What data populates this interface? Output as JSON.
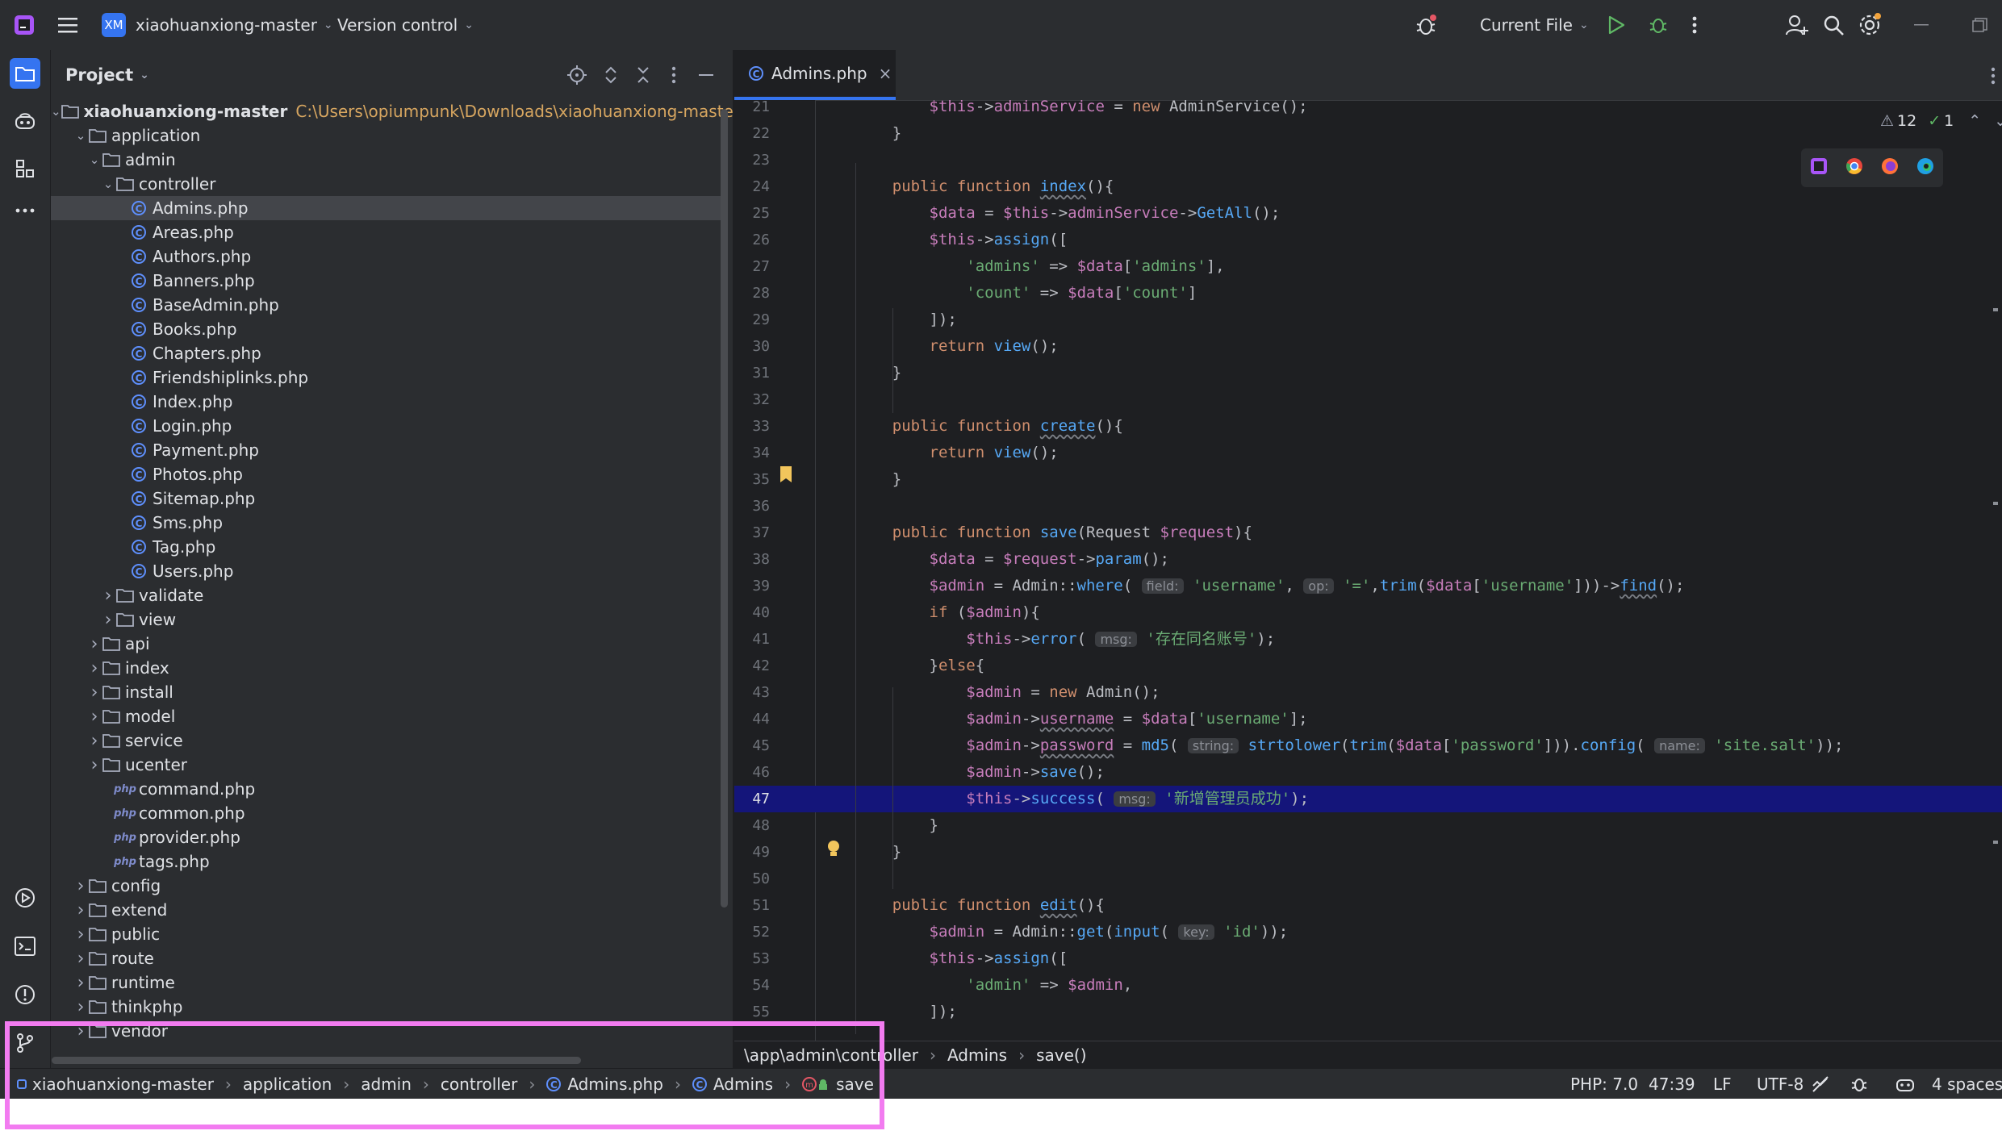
{
  "titlebar": {
    "project_badge": "XM",
    "project_name": "xiaohuanxiong-master",
    "vcs_label": "Version control",
    "run_config": "Current File",
    "colors": {
      "badge_bg": "#3574f0",
      "run_green": "#5fb865"
    }
  },
  "project_panel": {
    "title": "Project",
    "root": {
      "name": "xiaohuanxiong-master",
      "path": "C:\\Users\\opiumpunk\\Downloads\\xiaohuanxiong-master\\x"
    },
    "tree": [
      {
        "label": "application",
        "kind": "folder",
        "state": "open"
      },
      {
        "label": "admin",
        "kind": "folder",
        "state": "open"
      },
      {
        "label": "controller",
        "kind": "folder",
        "state": "open"
      },
      {
        "label": "Admins.php",
        "kind": "class",
        "selected": true
      },
      {
        "label": "Areas.php",
        "kind": "class"
      },
      {
        "label": "Authors.php",
        "kind": "class"
      },
      {
        "label": "Banners.php",
        "kind": "class"
      },
      {
        "label": "BaseAdmin.php",
        "kind": "class"
      },
      {
        "label": "Books.php",
        "kind": "class"
      },
      {
        "label": "Chapters.php",
        "kind": "class"
      },
      {
        "label": "Friendshiplinks.php",
        "kind": "class"
      },
      {
        "label": "Index.php",
        "kind": "class"
      },
      {
        "label": "Login.php",
        "kind": "class"
      },
      {
        "label": "Payment.php",
        "kind": "class"
      },
      {
        "label": "Photos.php",
        "kind": "class"
      },
      {
        "label": "Sitemap.php",
        "kind": "class"
      },
      {
        "label": "Sms.php",
        "kind": "class"
      },
      {
        "label": "Tag.php",
        "kind": "class"
      },
      {
        "label": "Users.php",
        "kind": "class"
      },
      {
        "label": "validate",
        "kind": "folder",
        "state": "closed"
      },
      {
        "label": "view",
        "kind": "folder",
        "state": "closed"
      },
      {
        "label": "api",
        "kind": "folder",
        "state": "closed"
      },
      {
        "label": "index",
        "kind": "folder",
        "state": "closed"
      },
      {
        "label": "install",
        "kind": "folder",
        "state": "closed"
      },
      {
        "label": "model",
        "kind": "folder",
        "state": "closed"
      },
      {
        "label": "service",
        "kind": "folder",
        "state": "closed"
      },
      {
        "label": "ucenter",
        "kind": "folder",
        "state": "closed"
      },
      {
        "label": "command.php",
        "kind": "php"
      },
      {
        "label": "common.php",
        "kind": "php"
      },
      {
        "label": "provider.php",
        "kind": "php"
      },
      {
        "label": "tags.php",
        "kind": "php"
      },
      {
        "label": "config",
        "kind": "folder",
        "state": "closed"
      },
      {
        "label": "extend",
        "kind": "folder",
        "state": "closed"
      },
      {
        "label": "public",
        "kind": "folder",
        "state": "closed"
      },
      {
        "label": "route",
        "kind": "folder",
        "state": "closed"
      },
      {
        "label": "runtime",
        "kind": "folder",
        "state": "closed"
      },
      {
        "label": "thinkphp",
        "kind": "folder",
        "state": "closed"
      },
      {
        "label": "vendor",
        "kind": "folder",
        "state": "closed"
      }
    ]
  },
  "editor": {
    "tab": "Admins.php",
    "inspections": {
      "warnings": "12",
      "ok": "1"
    },
    "current_line": "47",
    "code": [
      {
        "n": "21",
        "html": "        <span class=\"var\">$this</span>-><span class=\"var\">adminService</span> = <span class=\"kw\">new</span> AdminService();"
      },
      {
        "n": "22",
        "html": "    }"
      },
      {
        "n": "23",
        "html": ""
      },
      {
        "n": "24",
        "html": "    <span class=\"kw\">public function</span> <span class=\"fn ul\">index</span>(){"
      },
      {
        "n": "25",
        "html": "        <span class=\"var\">$data</span> = <span class=\"var\">$this</span>-><span class=\"var\">adminService</span>-><span class=\"fn\">GetAll</span>();"
      },
      {
        "n": "26",
        "html": "        <span class=\"var\">$this</span>-><span class=\"fn\">assign</span>(["
      },
      {
        "n": "27",
        "html": "            <span class=\"str\">'admins'</span> => <span class=\"var\">$data</span>[<span class=\"str\">'admins'</span>],"
      },
      {
        "n": "28",
        "html": "            <span class=\"str\">'count'</span> => <span class=\"var\">$data</span>[<span class=\"str\">'count'</span>]"
      },
      {
        "n": "29",
        "html": "        ]);"
      },
      {
        "n": "30",
        "html": "        <span class=\"kw\">return</span> <span class=\"fn\">view</span>();"
      },
      {
        "n": "31",
        "html": "    }"
      },
      {
        "n": "32",
        "html": ""
      },
      {
        "n": "33",
        "html": "    <span class=\"kw\">public function</span> <span class=\"fn ul\">create</span>(){"
      },
      {
        "n": "34",
        "html": "        <span class=\"kw\">return</span> <span class=\"fn\">view</span>();"
      },
      {
        "n": "35",
        "html": "    }"
      },
      {
        "n": "36",
        "html": ""
      },
      {
        "n": "37",
        "html": "    <span class=\"kw\">public function</span> <span class=\"fn\">save</span>(Request <span class=\"var\">$request</span>){"
      },
      {
        "n": "38",
        "html": "        <span class=\"var\">$data</span> = <span class=\"var\">$request</span>-><span class=\"fn\">param</span>();"
      },
      {
        "n": "39",
        "html": "        <span class=\"var\">$admin</span> = Admin::<span class=\"fn\">where</span>( <span class=\"hint\">field:</span> <span class=\"str\">'username'</span>, <span class=\"hint\">op:</span> <span class=\"str\">'='</span>,<span class=\"fn\">trim</span>(<span class=\"var\">$data</span>[<span class=\"str\">'username'</span>]))-><span class=\"fn ul\">find</span>();"
      },
      {
        "n": "40",
        "html": "        <span class=\"kw\">if</span> (<span class=\"var\">$admin</span>){"
      },
      {
        "n": "41",
        "html": "            <span class=\"var\">$this</span>-><span class=\"fn\">error</span>( <span class=\"hint\">msg:</span> <span class=\"str\">'存在同名账号'</span>);"
      },
      {
        "n": "42",
        "html": "        }<span class=\"kw\">else</span>{"
      },
      {
        "n": "43",
        "html": "            <span class=\"var\">$admin</span> = <span class=\"kw\">new</span> Admin();"
      },
      {
        "n": "44",
        "html": "            <span class=\"var\">$admin</span>-><span class=\"var ul\">username</span> = <span class=\"var\">$data</span>[<span class=\"str\">'username'</span>];"
      },
      {
        "n": "45",
        "html": "            <span class=\"var\">$admin</span>-><span class=\"var ul\">password</span> = <span class=\"fn\">md5</span>( <span class=\"hint\">string:</span> <span class=\"fn\">strtolower</span>(<span class=\"fn\">trim</span>(<span class=\"var\">$data</span>[<span class=\"str\">'password'</span>])).<span class=\"fn\">config</span>( <span class=\"hint\">name:</span> <span class=\"str\">'site.salt'</span>));"
      },
      {
        "n": "46",
        "html": "            <span class=\"var\">$admin</span>-><span class=\"fn\">save</span>();"
      },
      {
        "n": "47",
        "html": "            <span class=\"var\">$this</span>-><span class=\"fn\">success</span>( <span class=\"hint\">msg:</span> <span class=\"str\">'新增管理员成功'</span>);"
      },
      {
        "n": "48",
        "html": "        }"
      },
      {
        "n": "49",
        "html": "    }"
      },
      {
        "n": "50",
        "html": ""
      },
      {
        "n": "51",
        "html": "    <span class=\"kw\">public function</span> <span class=\"fn ul\">edit</span>(){"
      },
      {
        "n": "52",
        "html": "        <span class=\"var\">$admin</span> = Admin::<span class=\"fn\">get</span>(<span class=\"fn\">input</span>( <span class=\"hint\">key:</span> <span class=\"str\">'id'</span>));"
      },
      {
        "n": "53",
        "html": "        <span class=\"var\">$this</span>-><span class=\"fn\">assign</span>(["
      },
      {
        "n": "54",
        "html": "            <span class=\"str\">'admin'</span> => <span class=\"var\">$admin</span>,"
      },
      {
        "n": "55",
        "html": "        ]);"
      }
    ],
    "crumbs": [
      "\\app\\admin\\controller",
      "Admins",
      "save()"
    ]
  },
  "statusbar": {
    "path": [
      "xiaohuanxiong-master",
      "application",
      "admin",
      "controller",
      "Admins.php",
      "Admins",
      "save"
    ],
    "php_version": "PHP: 7.0",
    "caret": "47:39",
    "line_sep": "LF",
    "encoding": "UTF-8",
    "indent": "4 spaces"
  },
  "accent_colors": {
    "highlight_frame": "#f27bf0",
    "current_line": "#14157a",
    "selection": "#43454a"
  }
}
